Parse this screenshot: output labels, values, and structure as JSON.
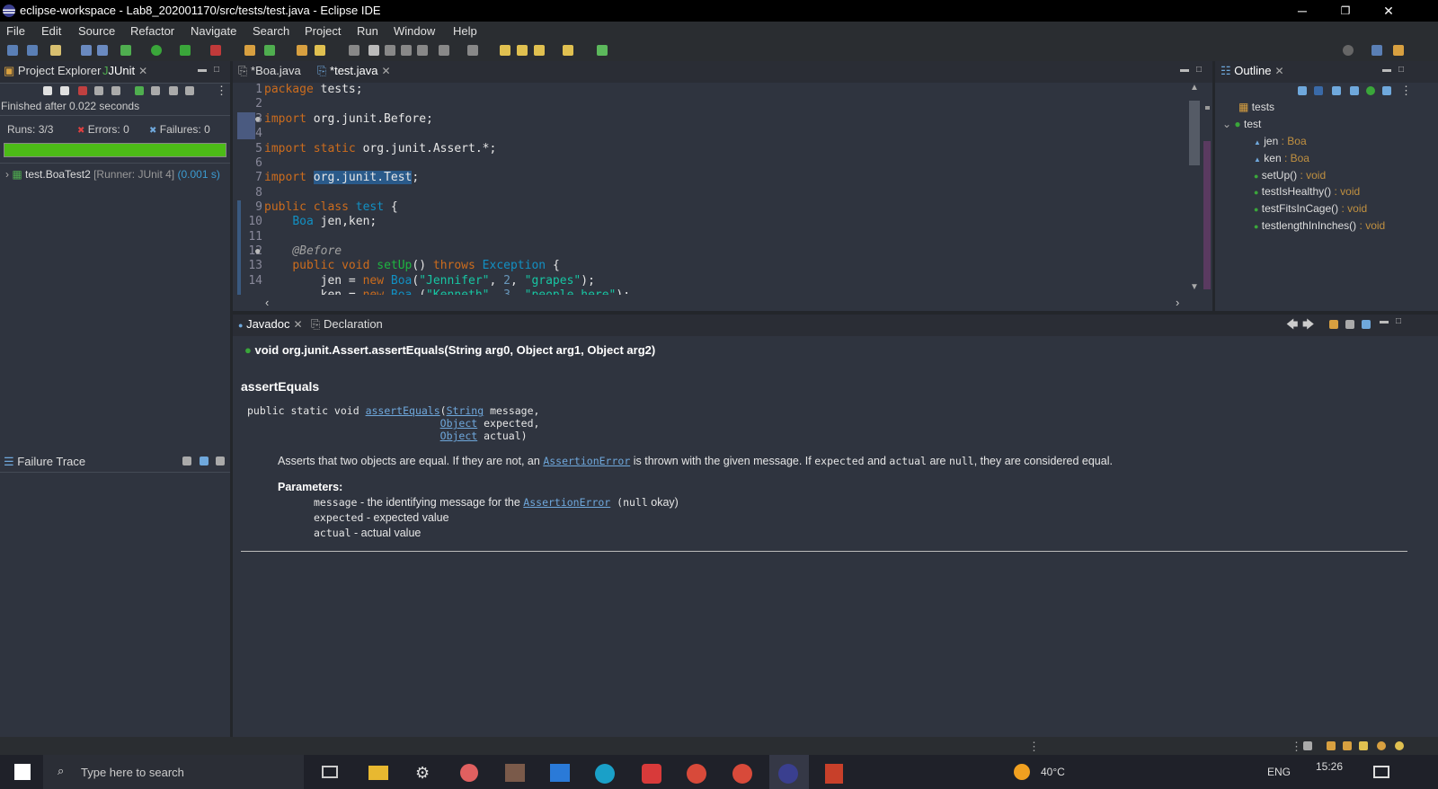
{
  "window": {
    "title": "eclipse-workspace - Lab8_202001170/src/tests/test.java - Eclipse IDE",
    "minimize": "─",
    "restore": "❐",
    "close": "✕"
  },
  "menu": [
    "File",
    "Edit",
    "Source",
    "Refactor",
    "Navigate",
    "Search",
    "Project",
    "Run",
    "Window",
    "Help"
  ],
  "left_tabs": {
    "project_explorer": "Project Explorer",
    "junit": "JUnit"
  },
  "junit": {
    "finished": "Finished after 0.022 seconds",
    "runs_label": "Runs:",
    "runs_value": "3/3",
    "errors_label": "Errors:",
    "errors_value": "0",
    "failures_label": "Failures:",
    "failures_value": "0",
    "progress": 1.0,
    "progress_color": "#4cbb17",
    "tree_item": "test.BoaTest2",
    "tree_runner": "[Runner: JUnit 4]",
    "tree_time": "(0.001 s)"
  },
  "failure_trace": {
    "title": "Failure Trace"
  },
  "editor_tabs": [
    {
      "label": "*Boa.java"
    },
    {
      "label": "*test.java"
    }
  ],
  "code": {
    "line_numbers": [
      "1",
      "2",
      "3",
      "4",
      "5",
      "6",
      "7",
      "8",
      "9",
      "10",
      "11",
      "12",
      "13",
      "14"
    ]
  },
  "outline": {
    "title": "Outline",
    "package": "tests",
    "class": "test",
    "members": [
      {
        "name": "jen",
        "type": " : Boa"
      },
      {
        "name": "ken",
        "type": " : Boa"
      },
      {
        "name": "setUp()",
        "type": " : void"
      },
      {
        "name": "testIsHealthy()",
        "type": " : void"
      },
      {
        "name": "testFitsInCage()",
        "type": " : void"
      },
      {
        "name": "testlengthInInches()",
        "type": " : void"
      }
    ]
  },
  "bottom_tabs": {
    "javadoc": "Javadoc",
    "declaration": "Declaration"
  },
  "javadoc": {
    "signature": "void org.junit.Assert.assertEquals(String arg0, Object arg1, Object arg2)",
    "heading": "assertEquals",
    "decl_prefix": "public static void ",
    "decl_method": "assertEquals",
    "decl_type1": "String",
    "decl_p1": " message,",
    "decl_type2": "Object",
    "decl_p2": " expected,",
    "decl_type3": "Object",
    "decl_p3": " actual)",
    "desc_1": "Asserts that two objects are equal. If they are not, an ",
    "desc_link": "AssertionError",
    "desc_2": " is thrown with the given message. If ",
    "desc_code1": "expected",
    "desc_3": " and ",
    "desc_code2": "actual",
    "desc_4": " are ",
    "desc_code3": "null",
    "desc_5": ", they are considered equal.",
    "params_title": "Parameters:",
    "p1_code": "message",
    "p1_text": " - the identifying message for the ",
    "p1_link": "AssertionError",
    "p1_code2": " (null",
    "p1_tail": " okay)",
    "p2_code": "expected",
    "p2_text": " - expected value",
    "p3_code": "actual",
    "p3_text": " - actual value"
  },
  "taskbar": {
    "search_placeholder": "Type here to search",
    "time": "15:26",
    "temp": "40°C",
    "lang": "ENG"
  }
}
